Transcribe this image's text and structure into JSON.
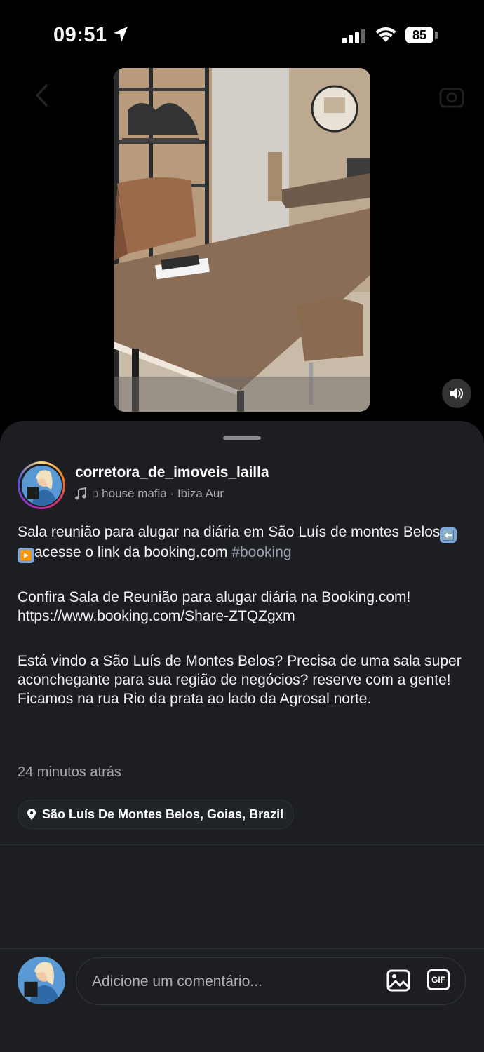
{
  "status_bar": {
    "time": "09:51",
    "battery": "85"
  },
  "post": {
    "username": "corretora_de_imoveis_lailla",
    "audio": "p house mafia · Ibiza Aur",
    "caption": {
      "line1": "Sala reunião para alugar na diária em São Luís de montes Belos",
      "line1_emoji": "⬅️",
      "line2_emoji": "▶️",
      "line2": "acesse o link da booking.com ",
      "hashtag": "#booking",
      "para2_line1": "Confira Sala de Reunião para alugar diária na Booking.com!",
      "para2_line2": "https://www.booking.com/Share-ZTQZgxm",
      "para3": "Está vindo a São Luís de Montes Belos? Precisa de uma sala super aconchegante para sua região de negócios? reserve com a gente! Ficamos na rua Rio da prata ao lado da Agrosal norte."
    },
    "timestamp": "24 minutos atrás",
    "location": "São Luís De Montes Belos, Goias, Brazil"
  },
  "comment": {
    "placeholder": "Adicione um comentário...",
    "gif_label": "GIF"
  },
  "icons": [
    "location-arrow-icon",
    "signal-icon",
    "wifi-icon",
    "battery-icon",
    "back-icon",
    "camera-icon",
    "speaker-icon",
    "music-note-icon",
    "location-pin-icon",
    "image-icon",
    "gif-icon"
  ]
}
